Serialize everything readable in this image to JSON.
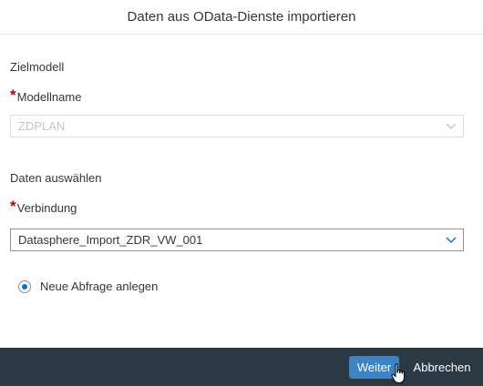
{
  "dialog": {
    "title": "Daten aus OData-Dienste importieren"
  },
  "target": {
    "section_title": "Zielmodell",
    "model_label": "Modellname",
    "model_value": "ZDPLAN"
  },
  "data": {
    "section_title": "Daten auswählen",
    "connection_label": "Verbindung",
    "connection_value": "Datasphere_Import_ZDR_VW_001"
  },
  "query": {
    "radio_label": "Neue Abfrage anlegen",
    "selected": true
  },
  "footer": {
    "next_label": "Weiter",
    "cancel_label": "Abbrechen"
  },
  "colors": {
    "accent": "#0a6ed1",
    "required": "#bb0000",
    "footer_bg": "#2b3945",
    "primary_button": "#3d84c6"
  },
  "icons": {
    "dropdown": "chevron-down-icon",
    "cursor": "hand-pointer-icon"
  }
}
